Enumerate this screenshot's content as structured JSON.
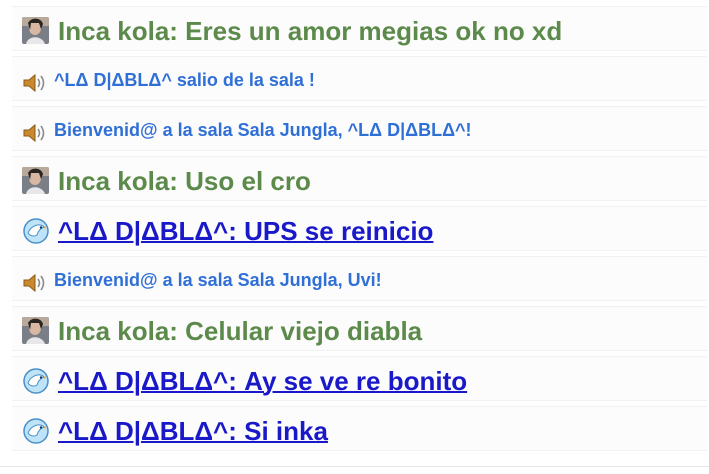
{
  "messages": [
    {
      "kind": "user",
      "text": "Inca kola: Eres un amor megias ok no xd",
      "icon": "user-avatar"
    },
    {
      "kind": "system",
      "text": "^LΔ D|ΔBLΔ^ salio de la sala !",
      "icon": "speaker-icon"
    },
    {
      "kind": "system",
      "text": "Bienvenid@ a la sala Sala Jungla, ^LΔ D|ΔBLΔ^!",
      "icon": "speaker-icon"
    },
    {
      "kind": "user",
      "text": "Inca kola: Uso el cro",
      "icon": "user-avatar"
    },
    {
      "kind": "link",
      "text": "^LΔ D|ΔBLΔ^: UPS se reinicio",
      "icon": "bird-icon"
    },
    {
      "kind": "system",
      "text": "Bienvenid@ a la sala Sala Jungla, Uvi!",
      "icon": "speaker-icon"
    },
    {
      "kind": "user",
      "text": "Inca kola: Celular viejo diabla",
      "icon": "user-avatar"
    },
    {
      "kind": "link",
      "text": "^LΔ D|ΔBLΔ^: Ay se ve re bonito",
      "icon": "bird-icon"
    },
    {
      "kind": "link",
      "text": "^LΔ D|ΔBLΔ^: Si inka",
      "icon": "bird-icon"
    }
  ],
  "colors": {
    "user_text": "#5c8a4a",
    "system_text": "#2f6fd6",
    "link_text": "#1a19c9"
  }
}
